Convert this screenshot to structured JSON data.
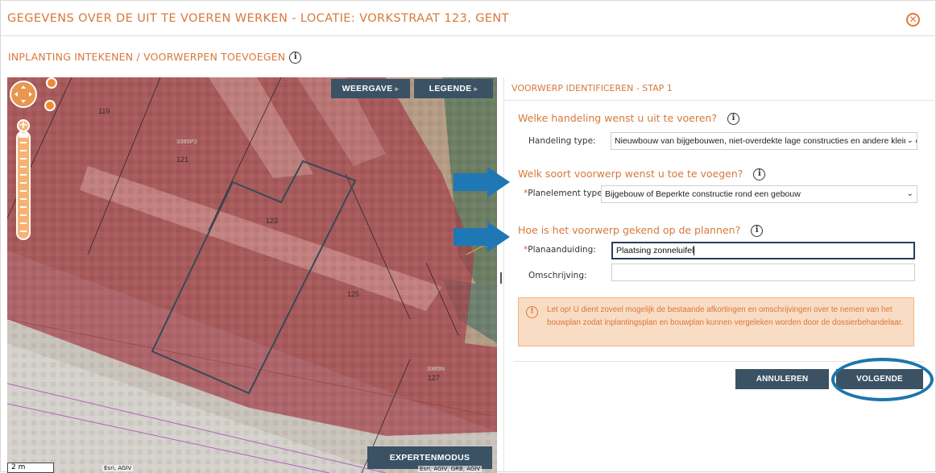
{
  "dialog": {
    "title": "GEGEVENS OVER DE UIT TE VOEREN WERKEN - LOCATIE: VORKSTRAAT 123, GENT",
    "close_icon": "⊗",
    "subtitle": "INPLANTING INTEKENEN / VOORWERPEN TOEVOEGEN",
    "info_glyph": "i"
  },
  "map": {
    "buttons": {
      "weergave": "WEERGAVE",
      "legende": "LEGENDE",
      "expertenmodus": "EXPERTENMODUS"
    },
    "caret": "▸",
    "zoom_plus": "+",
    "parcel_labels": [
      "119",
      "121",
      "123",
      "125",
      "127"
    ],
    "parcel_ids": [
      "3385P2",
      "3385N"
    ],
    "scale_label": "2 m",
    "attribution_1": "Esri, AGIV",
    "attribution_2": "Esri, AGIV, GRB, AGIV"
  },
  "panel": {
    "step_header": "VOORWERP IDENTIFICEREN - STAP 1",
    "q1": "Welke handeling wenst u uit te voeren?",
    "handeling_label": "Handeling type:",
    "handeling_value": "Nieuwbouw van bijgebouwen, niet-overdekte lage constructies en andere kleine constructies",
    "q2": "Welk soort voorwerp wenst u toe te voegen?",
    "planelement_label": "Planelement type:",
    "planelement_value": "Bijgebouw of Beperkte constructie rond een gebouw",
    "q3": "Hoe is het voorwerp gekend op de plannen?",
    "planaanduiding_label": "Planaanduiding:",
    "planaanduiding_value": "Plaatsing zonneluifel",
    "omschrijving_label": "Omschrijving:",
    "omschrijving_value": "",
    "required_mark": "*",
    "chevron": "⌄",
    "warning_icon": "!",
    "warning_text": "Let op! U dient zoveel mogelijk de bestaande afkortingen en omschrijvingen over te nemen van het bouwplan zodat inplantingsplan en bouwplan kunnen vergeleken worden door de dossierbehandelaar.",
    "btn_cancel": "ANNULEREN",
    "btn_next": "VOLGENDE"
  },
  "colors": {
    "accent_orange": "#d8783a",
    "button_slate": "#3a5264",
    "highlight_blue": "#1e75ad",
    "warning_bg": "#f9dcc4"
  }
}
